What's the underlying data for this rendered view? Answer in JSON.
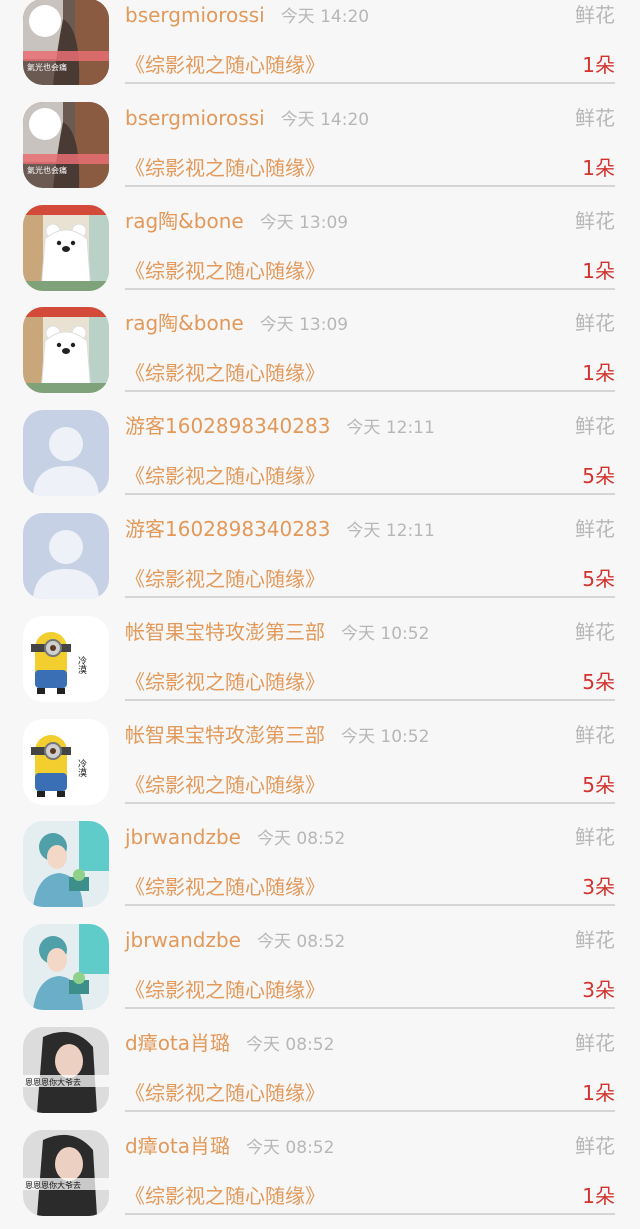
{
  "rows": [
    {
      "name": "bsergmiorossi",
      "time": "今天 14:20",
      "gift": "鲜花",
      "work": "《综影视之随心随缘》",
      "count": "1朵",
      "avatar": "photo-person-icon",
      "avatar_caption": "氣光也会痛"
    },
    {
      "name": "bsergmiorossi",
      "time": "今天 14:20",
      "gift": "鲜花",
      "work": "《综影视之随心随缘》",
      "count": "1朵",
      "avatar": "photo-person-icon",
      "avatar_caption": "氣光也会痛"
    },
    {
      "name": "rag陶&bone",
      "time": "今天 13:09",
      "gift": "鲜花",
      "work": "《综影视之随心随缘》",
      "count": "1朵",
      "avatar": "polar-bear-icon"
    },
    {
      "name": "rag陶&bone",
      "time": "今天 13:09",
      "gift": "鲜花",
      "work": "《综影视之随心随缘》",
      "count": "1朵",
      "avatar": "polar-bear-icon"
    },
    {
      "name": "游客1602898340283",
      "time": "今天 12:11",
      "gift": "鲜花",
      "work": "《综影视之随心随缘》",
      "count": "5朵",
      "avatar": "default-user-icon"
    },
    {
      "name": "游客1602898340283",
      "time": "今天 12:11",
      "gift": "鲜花",
      "work": "《综影视之随心随缘》",
      "count": "5朵",
      "avatar": "default-user-icon"
    },
    {
      "name": "帐智果宝特攻澎第三部",
      "time": "今天 10:52",
      "gift": "鲜花",
      "work": "《综影视之随心随缘》",
      "count": "5朵",
      "avatar": "minion-icon",
      "avatar_caption": "冷漠"
    },
    {
      "name": "帐智果宝特攻澎第三部",
      "time": "今天 10:52",
      "gift": "鲜花",
      "work": "《综影视之随心随缘》",
      "count": "5朵",
      "avatar": "minion-icon",
      "avatar_caption": "冷漠"
    },
    {
      "name": "jbrwandzbe",
      "time": "今天 08:52",
      "gift": "鲜花",
      "work": "《综影视之随心随缘》",
      "count": "3朵",
      "avatar": "illustrated-girl-icon"
    },
    {
      "name": "jbrwandzbe",
      "time": "今天 08:52",
      "gift": "鲜花",
      "work": "《综影视之随心随缘》",
      "count": "3朵",
      "avatar": "illustrated-girl-icon"
    },
    {
      "name": "d瘴ota肖璐",
      "time": "今天 08:52",
      "gift": "鲜花",
      "work": "《综影视之随心随缘》",
      "count": "1朵",
      "avatar": "photo-woman-icon",
      "avatar_caption": "恩恩恩你大爷去"
    },
    {
      "name": "d瘴ota肖璐",
      "time": "今天 08:52",
      "gift": "鲜花",
      "work": "《综影视之随心随缘》",
      "count": "1朵",
      "avatar": "photo-woman-icon",
      "avatar_caption": "恩恩恩你大爷去"
    }
  ]
}
